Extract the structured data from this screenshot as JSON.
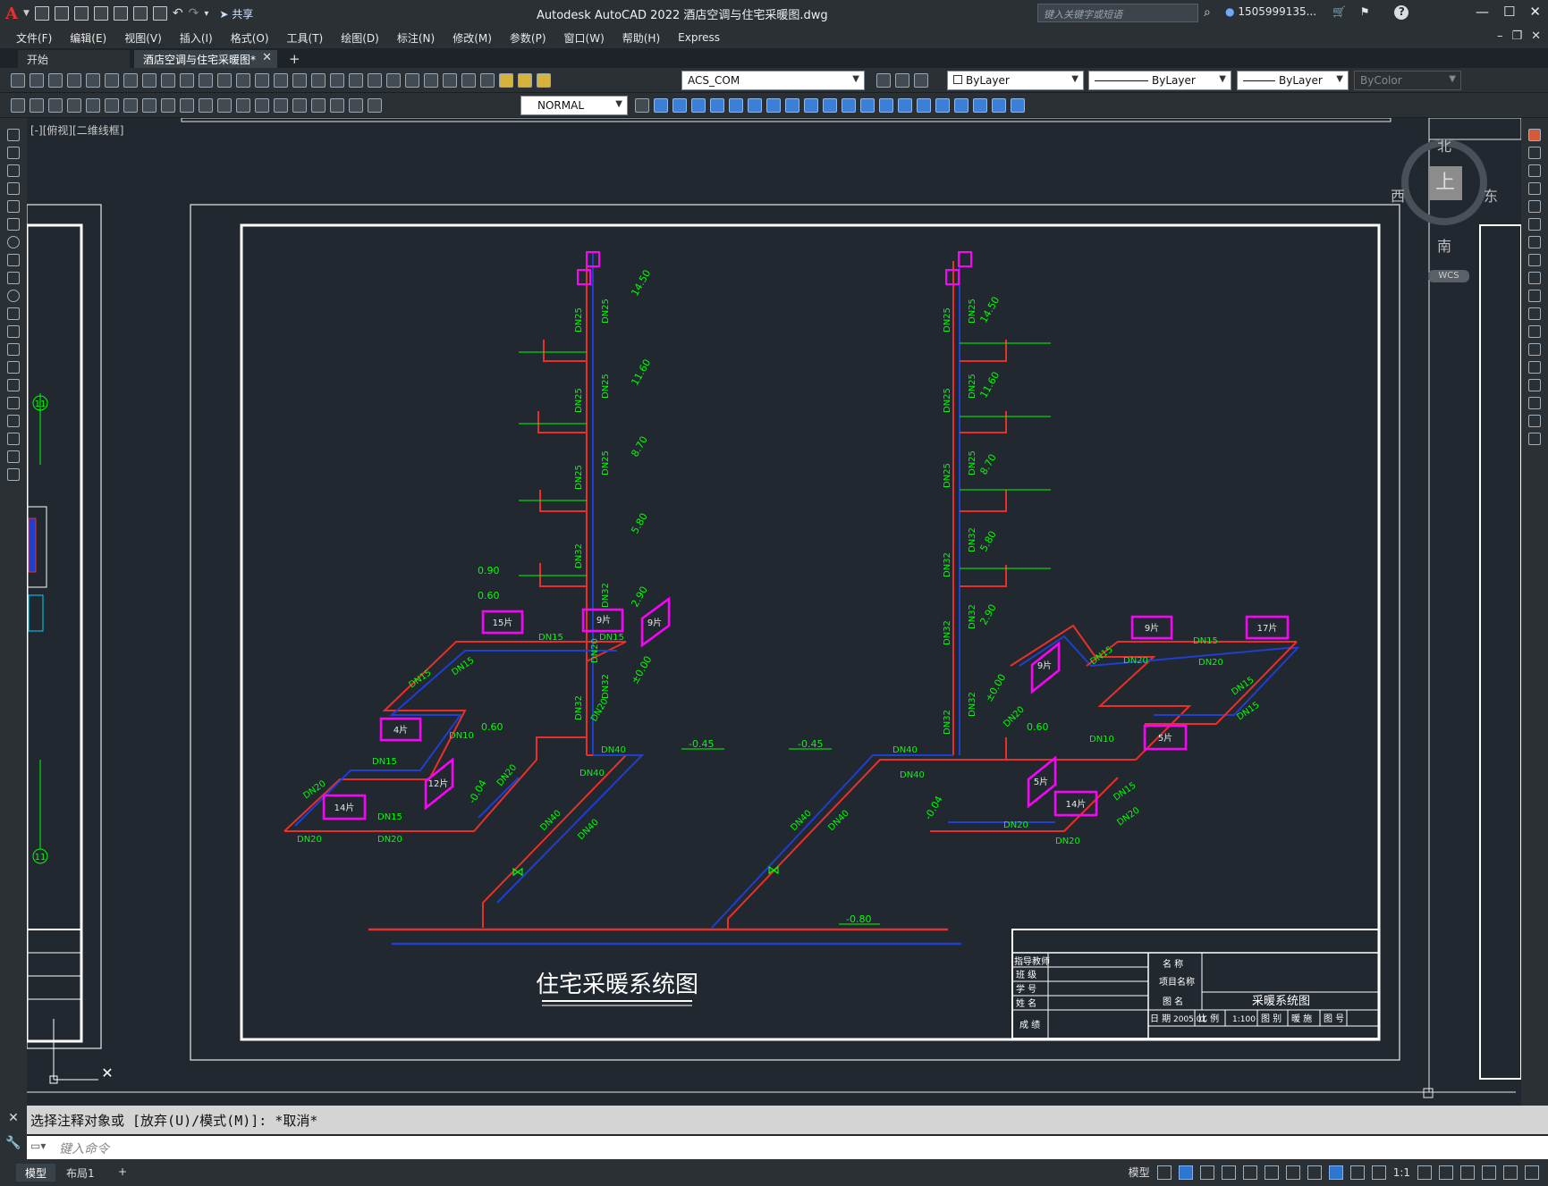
{
  "titlebar": {
    "app_logo": "A",
    "share": "共享",
    "title": "Autodesk AutoCAD 2022    酒店空调与住宅采暖图.dwg",
    "search_placeholder": "键入关键字或短语",
    "user": "1505999135...",
    "help": "?"
  },
  "menu": [
    "文件(F)",
    "编辑(E)",
    "视图(V)",
    "插入(I)",
    "格式(O)",
    "工具(T)",
    "绘图(D)",
    "标注(N)",
    "修改(M)",
    "参数(P)",
    "窗口(W)",
    "帮助(H)",
    "Express"
  ],
  "tabs": {
    "start": "开始",
    "active": "酒店空调与住宅采暖图*",
    "add": "+"
  },
  "toolbar": {
    "layer": "ACS_COM",
    "color": "ByLayer",
    "linetype": "ByLayer",
    "lineweight": "ByLayer",
    "plotstyle": "ByColor",
    "textstyle": "NORMAL"
  },
  "viewport_label": "[-][俯视][二维线框]",
  "viewcube": {
    "north": "北",
    "south": "南",
    "east": "东",
    "west": "西",
    "face": "上",
    "wcs": "WCS"
  },
  "drawing": {
    "title": "住宅采暖系统图",
    "elevations_left": [
      "14.50",
      "11.60",
      "8.70",
      "5.80",
      "2.90",
      "±0.00",
      "0.90",
      "0.60",
      "0.60",
      "-0.45",
      "-0.04"
    ],
    "elevations_right": [
      "14.50",
      "11.60",
      "8.70",
      "5.80",
      "2.90",
      "±0.00",
      "0.60",
      "-0.45",
      "-0.04"
    ],
    "ground_level": "-0.80",
    "riser_labels_left": [
      "DN25",
      "DN25",
      "DN25",
      "DN25",
      "DN25",
      "DN25",
      "DN32",
      "DN32",
      "DN20",
      "DN32",
      "DN32",
      "DN40",
      "DN40"
    ],
    "riser_labels_right": [
      "DN25",
      "DN25",
      "DN25",
      "DN25",
      "DN25",
      "DN25",
      "DN32",
      "DN32",
      "DN32",
      "DN32",
      "DN32",
      "DN32",
      "DN40",
      "DN40"
    ],
    "branch_labels_left": [
      "DN15",
      "DN15",
      "DN15",
      "DN15",
      "DN10",
      "DN15",
      "DN20",
      "DN20",
      "DN20",
      "DN15",
      "DN20",
      "DN20",
      "DN40",
      "DN40"
    ],
    "branch_labels_right": [
      "DN15",
      "DN20",
      "DN15",
      "DN20",
      "DN15",
      "DN15",
      "DN10",
      "DN20",
      "DN20",
      "DN15",
      "DN20",
      "DN20",
      "DN40",
      "DN40"
    ],
    "radiators_left": [
      "15片",
      "9片",
      "9片",
      "4片",
      "12片",
      "14片"
    ],
    "radiators_right": [
      "9片",
      "17片",
      "9片",
      "5片",
      "5片",
      "14片"
    ],
    "axis_markers": [
      "11",
      "11"
    ],
    "titleblock": {
      "labels_left": [
        "指导教师",
        "班 级",
        "学 号",
        "姓 名",
        "成 绩"
      ],
      "name": "名 称",
      "project": "项目名称",
      "drawing_name_label": "图 名",
      "drawing_name": "采暖系统图",
      "date_label": "日 期",
      "date": "2005.01",
      "scale_label": "比 例",
      "scale": "1:100",
      "extra": "图 别",
      "sheet": "暖 施",
      "number": "图 号"
    }
  },
  "command": {
    "history": "选择注释对象或 [放弃(U)/模式(M)]: *取消*",
    "placeholder": "键入命令"
  },
  "status": {
    "model": "模型",
    "layout1": "布局1",
    "add": "+",
    "model_btn": "模型",
    "scale": "1:1"
  }
}
